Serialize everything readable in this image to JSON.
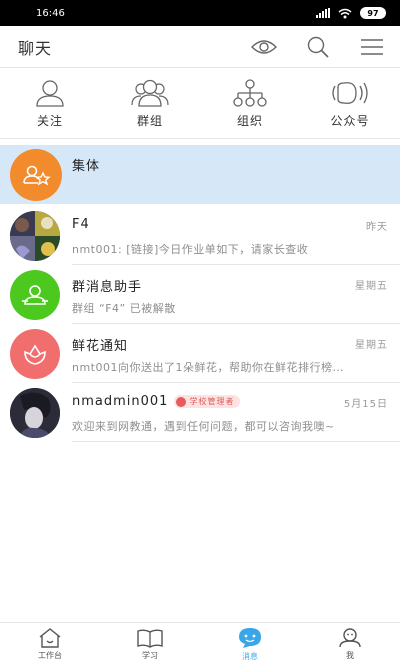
{
  "status_bar": {
    "time": "16:46",
    "battery": "97"
  },
  "header": {
    "title": "聊天"
  },
  "categories": [
    {
      "label": "关注",
      "icon": "person-icon"
    },
    {
      "label": "群组",
      "icon": "group-icon"
    },
    {
      "label": "组织",
      "icon": "org-chart-icon"
    },
    {
      "label": "公众号",
      "icon": "broadcast-icon"
    }
  ],
  "conversations": [
    {
      "name": "集体",
      "time": "",
      "message": "",
      "avatar_color": "#f28b2c"
    },
    {
      "name": "F4",
      "time": "昨天",
      "message": "nmt001: [链接]今日作业单如下，请家长查收",
      "avatar_color": "#2b2b2b"
    },
    {
      "name": "群消息助手",
      "time": "星期五",
      "message": "群组 “F4” 已被解散",
      "avatar_color": "#4cc81e"
    },
    {
      "name": "鲜花通知",
      "time": "星期五",
      "message": "nmt001向你送出了1朵鲜花，帮助你在鲜花排行榜…",
      "avatar_color": "#f16e6e"
    },
    {
      "name": "nmadmin001",
      "badge": "学校管理者",
      "time": "5月15日",
      "message": "欢迎来到网教通，遇到任何问题，都可以咨询我噢~",
      "avatar_color": "#3a3a44"
    }
  ],
  "bottom_nav": [
    {
      "label": "工作台",
      "icon": "home-icon"
    },
    {
      "label": "学习",
      "icon": "book-icon"
    },
    {
      "label": "消息",
      "icon": "message-icon",
      "active": true
    },
    {
      "label": "我",
      "icon": "profile-icon"
    }
  ],
  "colors": {
    "accent": "#3aa6e8",
    "pinned_bg": "#d6e8f8"
  }
}
